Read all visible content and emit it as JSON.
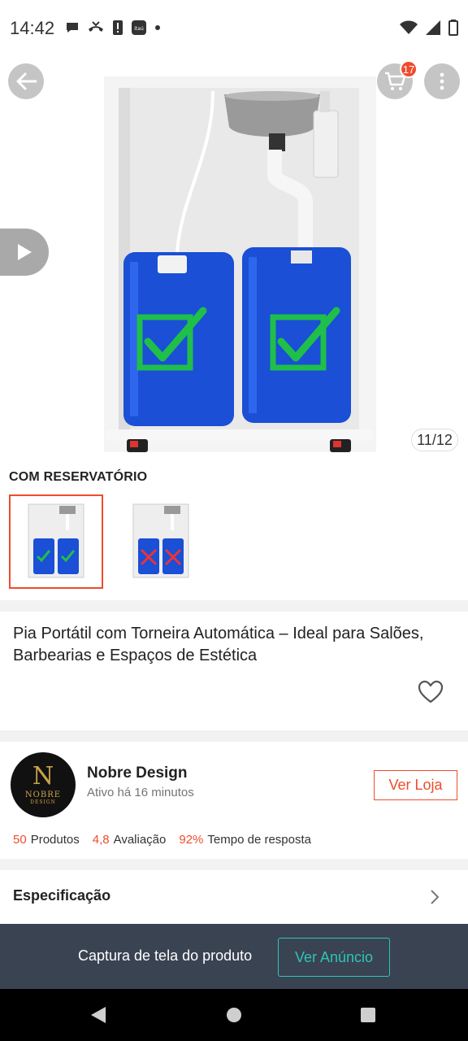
{
  "status_bar": {
    "time": "14:42"
  },
  "header": {
    "cart_count": "17"
  },
  "gallery": {
    "counter": "11/12"
  },
  "variation": {
    "title": "COM RESERVATÓRIO",
    "options_count_visible": 2,
    "selected_index": 0
  },
  "product": {
    "title": "Pia Portátil com Torneira Automática – Ideal para Salões, Barbearias e Espaços de Estética"
  },
  "seller": {
    "logo_monogram": "N",
    "logo_name": "NOBRE",
    "logo_sub": "DESIGN",
    "name": "Nobre Design",
    "active": "Ativo há 16 minutos",
    "shop_button": "Ver Loja",
    "stats": [
      {
        "value": "50",
        "label": "Produtos"
      },
      {
        "value": "4,8",
        "label": "Avaliação"
      },
      {
        "value": "92%",
        "label": "Tempo de resposta"
      }
    ]
  },
  "specification": {
    "label": "Especificação"
  },
  "capture_bar": {
    "text": "Captura de tela do produto",
    "button": "Ver Anúncio"
  },
  "colors": {
    "accent": "#ee4d2d",
    "teal": "#2ec4b6",
    "capture_bg": "#3a4352",
    "tank_blue": "#1a4fd6",
    "check_green": "#1fbf4a"
  }
}
